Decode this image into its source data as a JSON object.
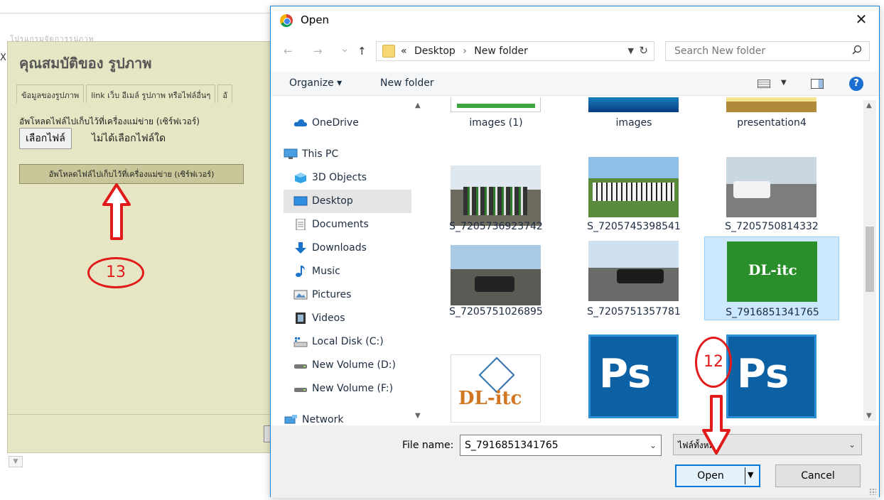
{
  "background": {
    "title": "คุณสมบัติของ รูปภาพ",
    "faint_text": "โปรแกรมจัดการรูปภาพ",
    "close_glyph": "X",
    "tabs": [
      {
        "label": "ข้อมูลของรูปภาพ"
      },
      {
        "label": "link เว็บ อีเมล์ รูปภาพ หรือไฟล์อื่นๆ"
      },
      {
        "label": "อั"
      }
    ],
    "upload_label": "อัพโหลดไฟล์ไปเก็บไว้ที่เครื่องแม่ข่าย (เซิร์ฟเวอร์)",
    "choose_file": "เลือกไฟล์",
    "no_file": "ไม่ได้เลือกไฟล์ใด",
    "upload_button": "อัพโหลดไฟล์ไปเก็บไว้ที่เครื่องแม่ข่าย (เซิร์ฟเวอร์)",
    "step_number": "13"
  },
  "dialog": {
    "title": "Open",
    "close": "✕",
    "nav": {
      "back": "←",
      "forward": "→",
      "recent": "⌄",
      "up": "↑"
    },
    "address": {
      "prefix": "«",
      "crumbs": [
        "Desktop",
        "New folder"
      ],
      "separator": "›"
    },
    "search_placeholder": "Search New folder",
    "toolbar": {
      "organize": "Organize ▾",
      "new_folder": "New folder",
      "help": "?"
    },
    "nav_items": [
      {
        "label": "OneDrive",
        "icon": "cloud-icon"
      },
      {
        "label": "This PC",
        "icon": "computer-icon"
      },
      {
        "label": "3D Objects",
        "icon": "cube-icon"
      },
      {
        "label": "Desktop",
        "icon": "desktop-icon",
        "selected": true
      },
      {
        "label": "Documents",
        "icon": "document-icon"
      },
      {
        "label": "Downloads",
        "icon": "download-icon"
      },
      {
        "label": "Music",
        "icon": "music-icon"
      },
      {
        "label": "Pictures",
        "icon": "pictures-icon"
      },
      {
        "label": "Videos",
        "icon": "video-icon"
      },
      {
        "label": "Local Disk (C:)",
        "icon": "disk-icon"
      },
      {
        "label": "New Volume (D:)",
        "icon": "drive-icon"
      },
      {
        "label": "New Volume (F:)",
        "icon": "drive-icon"
      },
      {
        "label": "Network",
        "icon": "network-icon"
      }
    ],
    "files": [
      {
        "name": "images (1)"
      },
      {
        "name": "images"
      },
      {
        "name": "presentation4"
      },
      {
        "name": "S_7205736923742"
      },
      {
        "name": "S_7205745398541"
      },
      {
        "name": "S_7205750814332"
      },
      {
        "name": "S_7205751026895"
      },
      {
        "name": "S_7205751357781"
      },
      {
        "name": "S_7916851341765",
        "selected": true,
        "logo_text": "DL-itc"
      },
      {
        "name": "",
        "logo_text": "DL-itc"
      },
      {
        "name": "",
        "logo_text": "Ps"
      },
      {
        "name": "",
        "logo_text": "Ps"
      }
    ],
    "file_name_label": "File name:",
    "file_name_value": "S_7916851341765",
    "file_type": "ไฟล์ทั้งหมด",
    "open_button": "Open",
    "cancel_button": "Cancel",
    "step_number": "12"
  },
  "colors": {
    "accent": "#0078d7",
    "annotation": "#e11b1b",
    "bg_dialog": "#e7e6c4",
    "ps_blue": "#0b61a4"
  }
}
